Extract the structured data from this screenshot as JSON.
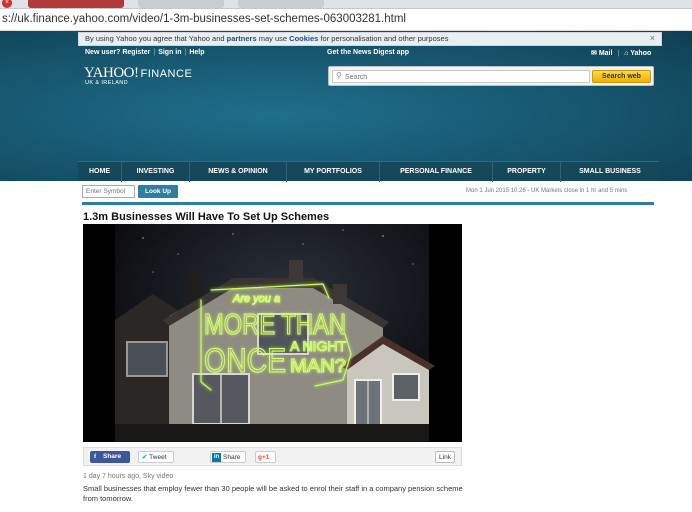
{
  "browser": {
    "url": "s://uk.finance.yahoo.com/video/1-3m-businesses-set-schemes-063003281.html"
  },
  "cookie_bar": {
    "text_before": "By using Yahoo you agree that Yahoo and ",
    "partners_link": "partners",
    "text_middle": " may use ",
    "cookies_link": "Cookies",
    "text_after": " for personalisation and other purposes",
    "close": "×"
  },
  "header": {
    "new_user": "New user? Register",
    "sign_in": "Sign in",
    "help": "Help",
    "news_app": "Get the News Digest app",
    "mail": "Mail",
    "yahoo": "Yahoo",
    "logo_yahoo": "YAHOO!",
    "logo_finance": "FINANCE",
    "logo_region": "UK & IRELAND"
  },
  "search": {
    "placeholder": "Search",
    "button": "Search web"
  },
  "nav": {
    "items": [
      "HOME",
      "INVESTING",
      "NEWS & OPINION",
      "MY PORTFOLIOS",
      "PERSONAL FINANCE",
      "PROPERTY",
      "SMALL BUSINESS"
    ]
  },
  "lookup": {
    "placeholder": "Enter Symbol",
    "button": "Look Up",
    "market_status": "Mon 1 Jun 2015 10:26 - UK Markets close in 1 hr and 5 mins"
  },
  "article": {
    "headline": "1.3m Businesses Will Have To Set Up Schemes",
    "meta": "1 day 7 hours ago, Sky video",
    "summary": "Small businesses that employ fewer than 30 people will be asked to enrol their staff in a company pension scheme from tomorrow."
  },
  "video": {
    "neon_line1": "Are you a",
    "neon_line2": "MORE THAN",
    "neon_line3": "A NIGHT",
    "neon_line4": "ONCE",
    "neon_line5": "MAN?",
    "neon_color": "#c9ff5a"
  },
  "share": {
    "facebook": "Share",
    "twitter": "Tweet",
    "linkedin": "Share",
    "gplus": "+1",
    "link": "Link"
  }
}
